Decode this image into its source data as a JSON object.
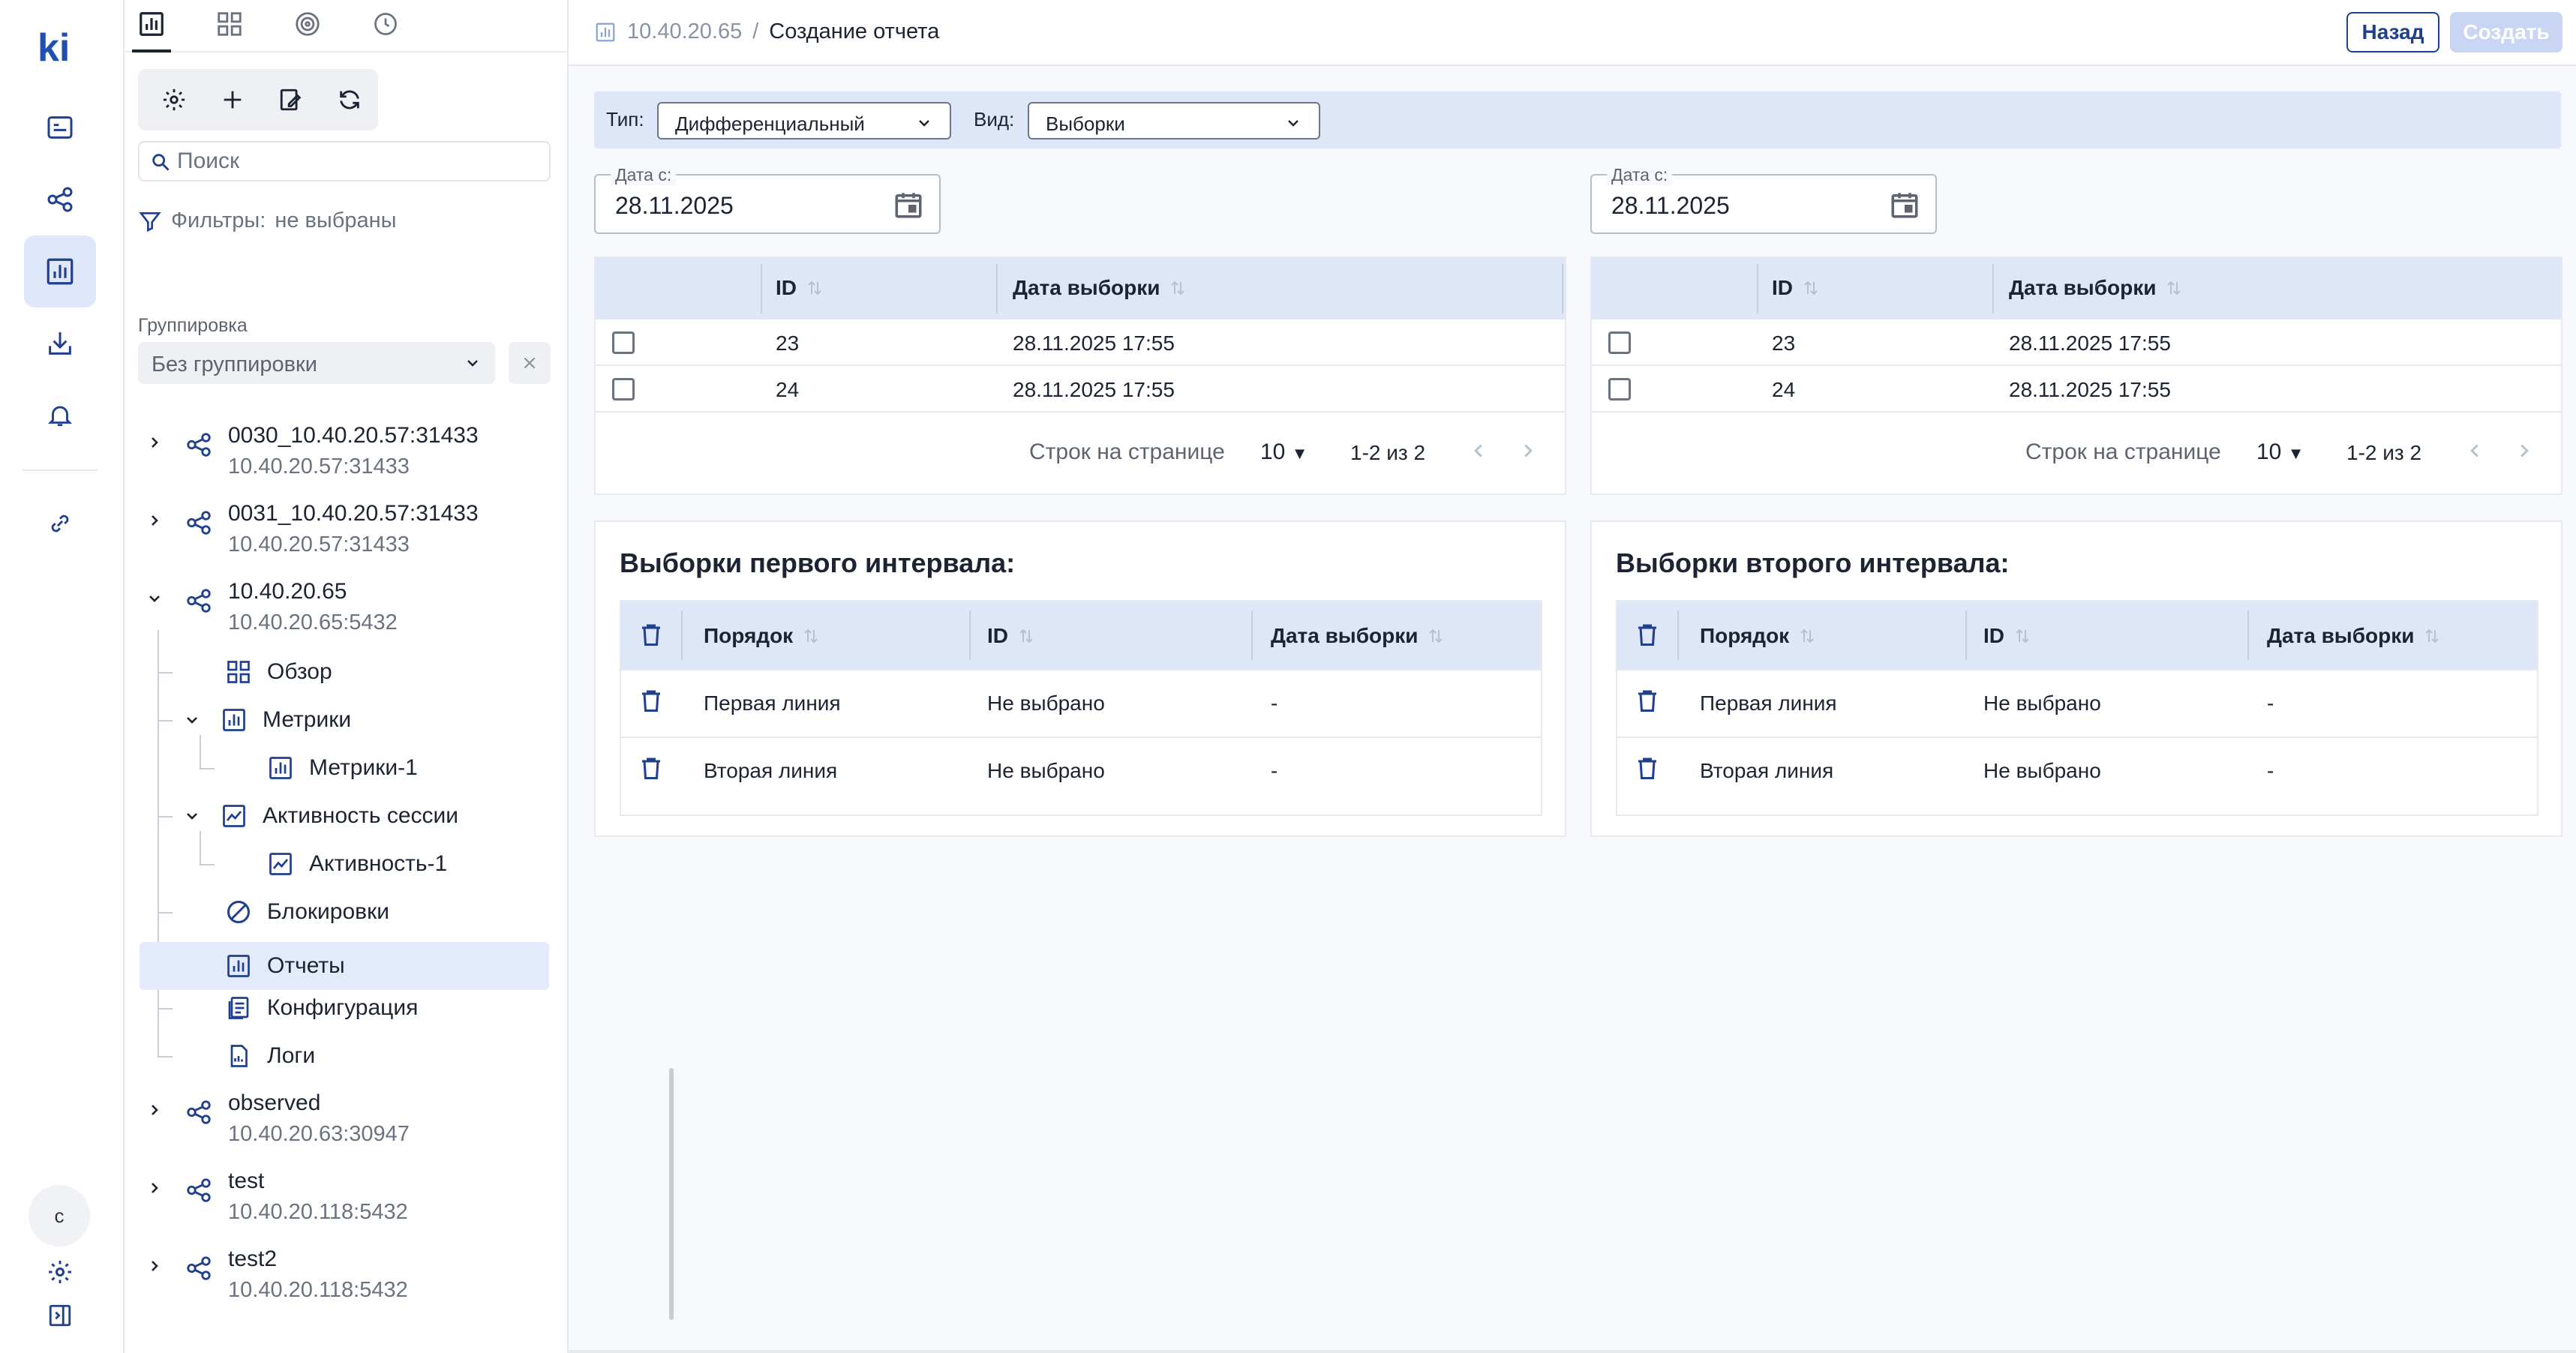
{
  "app": {
    "logo": "ki"
  },
  "colors": {
    "accent": "#1f3f8f",
    "header_bg": "#dde7f8",
    "selected_bg": "#e2eafb",
    "disabled_btn": "#c9d6f3"
  },
  "rail": {
    "icons": [
      "dashboard-icon",
      "topology-icon",
      "reports-icon",
      "download-icon",
      "bell-icon",
      "link-icon",
      "settings-icon",
      "collapse-icon"
    ],
    "avatar": "c"
  },
  "panel": {
    "tabs": [
      "chart-tab-icon",
      "grid-tab-icon",
      "target-tab-icon",
      "clock-tab-icon"
    ],
    "search_placeholder": "Поиск",
    "filters_label": "Фильтры:",
    "filters_value": "не выбраны",
    "group_label": "Группировка",
    "group_value": "Без группировки",
    "tree": [
      {
        "name": "0030_10.40.20.57:31433",
        "addr": "10.40.20.57:31433"
      },
      {
        "name": "0031_10.40.20.57:31433",
        "addr": "10.40.20.57:31433"
      },
      {
        "name": "10.40.20.65",
        "addr": "10.40.20.65:5432"
      },
      {
        "name": "observed",
        "addr": "10.40.20.63:30947"
      },
      {
        "name": "test",
        "addr": "10.40.20.118:5432"
      },
      {
        "name": "test2",
        "addr": "10.40.20.118:5432"
      }
    ],
    "children": {
      "overview": "Обзор",
      "metrics": "Метрики",
      "metrics1": "Метрики-1",
      "activity": "Активность сессии",
      "activity1": "Активность-1",
      "locks": "Блокировки",
      "reports": "Отчеты",
      "config": "Конфигурация",
      "logs": "Логи"
    }
  },
  "header": {
    "crumb_root": "10.40.20.65",
    "crumb_sep": "/",
    "crumb_current": "Создание отчета",
    "back": "Назад",
    "create": "Создать"
  },
  "filterbar": {
    "type_label": "Тип:",
    "type_value": "Дифференциальный",
    "view_label": "Вид:",
    "view_value": "Выборки"
  },
  "left": {
    "date_label": "Дата с:",
    "date_value": "28.11.2025",
    "col_id": "ID",
    "col_date": "Дата выборки",
    "rows": [
      {
        "id": "23",
        "date": "28.11.2025 17:55"
      },
      {
        "id": "24",
        "date": "28.11.2025 17:55"
      }
    ],
    "rows_label": "Строк на странице",
    "rows_value": "10",
    "range": "1-2 из 2",
    "sel_title": "Выборки первого интервала:",
    "sel_cols": [
      "Порядок",
      "ID",
      "Дата выборки"
    ],
    "sel_rows": [
      {
        "order": "Первая линия",
        "id": "Не выбрано",
        "date": "-"
      },
      {
        "order": "Вторая линия",
        "id": "Не выбрано",
        "date": "-"
      }
    ]
  },
  "right": {
    "date_label": "Дата с:",
    "date_value": "28.11.2025",
    "col_id": "ID",
    "col_date": "Дата выборки",
    "rows": [
      {
        "id": "23",
        "date": "28.11.2025 17:55"
      },
      {
        "id": "24",
        "date": "28.11.2025 17:55"
      }
    ],
    "rows_label": "Строк на странице",
    "rows_value": "10",
    "range": "1-2 из 2",
    "sel_title": "Выборки второго интервала:",
    "sel_cols": [
      "Порядок",
      "ID",
      "Дата выборки"
    ],
    "sel_rows": [
      {
        "order": "Первая линия",
        "id": "Не выбрано",
        "date": "-"
      },
      {
        "order": "Вторая линия",
        "id": "Не выбрано",
        "date": "-"
      }
    ]
  }
}
